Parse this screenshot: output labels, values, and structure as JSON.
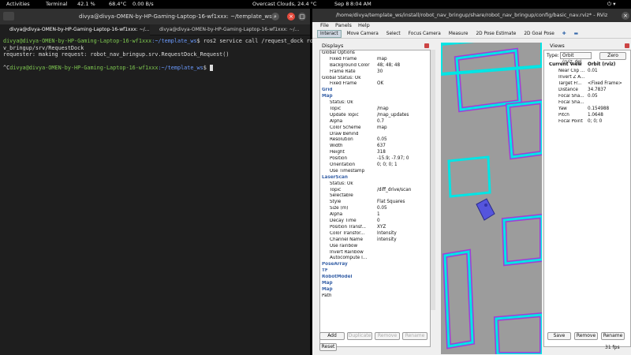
{
  "topbar": {
    "activities": "Activities",
    "terminal": "Terminal",
    "cpu": "42.1 %",
    "temp": "68.4°C",
    "net": "0.00 B/s",
    "weather": "Overcast Clouds, 24.4 °C",
    "date": "Sep 8",
    "time": "8:04 AM"
  },
  "terminal": {
    "title": "divya@divya-OMEN-by-HP-Gaming-Laptop-16-wf1xxx: ~/template_ws",
    "tab1": "divya@divya-OMEN-by-HP-Gaming-Laptop-16-wf1xxx: ~/...",
    "tab2": "divya@divya-OMEN-by-HP-Gaming-Laptop-16-wf1xxx: ~/...",
    "prompt_user": "divya@divya-OMEN-by-HP-Gaming-Laptop-16-wf1xxx",
    "prompt_path": ":~/template_ws",
    "cmd1": "$ ros2 service call /request_dock robot_na",
    "cmd1b": "v_bringup/srv/RequestDock",
    "out1": "requester: making request: robot_nav_bringup.srv.RequestDock_Request()",
    "ctrl": "^C",
    "prompt2_user": "divya@divya-OMEN-by-HP-Gaming-Laptop-16-wf1xxx",
    "prompt2_path": ":~/template_ws",
    "prompt2_end": "$ "
  },
  "rviz": {
    "title": "/home/divya/template_ws/install/robot_nav_bringup/share/robot_nav_bringup/config/basic_nav.rviz* - RViz",
    "menu": [
      "File",
      "Panels",
      "Help"
    ],
    "tools": [
      "Interact",
      "Move Camera",
      "Select",
      "Focus Camera",
      "Measure",
      "2D Pose Estimate",
      "2D Goal Pose"
    ],
    "displays_title": "Displays",
    "views_title": "Views",
    "rows": [
      {
        "k": "Global Options",
        "v": "",
        "d": 0
      },
      {
        "k": "Fixed Frame",
        "v": "map",
        "d": 1
      },
      {
        "k": "Background Color",
        "v": "48; 48; 48",
        "d": 1
      },
      {
        "k": "Frame Rate",
        "v": "30",
        "d": 1
      },
      {
        "k": "Global Status: Ok",
        "v": "",
        "d": 0
      },
      {
        "k": "Fixed Frame",
        "v": "OK",
        "d": 1
      },
      {
        "k": "Grid",
        "v": "",
        "d": 0,
        "s": 1
      },
      {
        "k": "Map",
        "v": "",
        "d": 0,
        "s": 1
      },
      {
        "k": "Status: Ok",
        "v": "",
        "d": 1
      },
      {
        "k": "Topic",
        "v": "/map",
        "d": 1
      },
      {
        "k": "Update Topic",
        "v": "/map_updates",
        "d": 1
      },
      {
        "k": "Alpha",
        "v": "0.7",
        "d": 1
      },
      {
        "k": "Color Scheme",
        "v": "map",
        "d": 1
      },
      {
        "k": "Draw Behind",
        "v": "",
        "d": 1
      },
      {
        "k": "Resolution",
        "v": "0.05",
        "d": 1
      },
      {
        "k": "Width",
        "v": "637",
        "d": 1
      },
      {
        "k": "Height",
        "v": "318",
        "d": 1
      },
      {
        "k": "Position",
        "v": "-15.9; -7.97; 0",
        "d": 1
      },
      {
        "k": "Orientation",
        "v": "0; 0; 0; 1",
        "d": 1
      },
      {
        "k": "Use Timestamp",
        "v": "",
        "d": 1
      },
      {
        "k": "LaserScan",
        "v": "",
        "d": 0,
        "s": 1
      },
      {
        "k": "Status: Ok",
        "v": "",
        "d": 1
      },
      {
        "k": "Topic",
        "v": "/diff_drive/scan",
        "d": 1
      },
      {
        "k": "Selectable",
        "v": "",
        "d": 1
      },
      {
        "k": "Style",
        "v": "Flat Squares",
        "d": 1
      },
      {
        "k": "Size (m)",
        "v": "0.05",
        "d": 1
      },
      {
        "k": "Alpha",
        "v": "1",
        "d": 1
      },
      {
        "k": "Decay Time",
        "v": "0",
        "d": 1
      },
      {
        "k": "Position Transf...",
        "v": "XYZ",
        "d": 1
      },
      {
        "k": "Color Transfor...",
        "v": "Intensity",
        "d": 1
      },
      {
        "k": "Channel Name",
        "v": "intensity",
        "d": 1
      },
      {
        "k": "Use rainbow",
        "v": "",
        "d": 1
      },
      {
        "k": "Invert Rainbow",
        "v": "",
        "d": 1
      },
      {
        "k": "Autocompute I...",
        "v": "",
        "d": 1
      },
      {
        "k": "PoseArray",
        "v": "",
        "d": 0,
        "s": 1
      },
      {
        "k": "TF",
        "v": "",
        "d": 0,
        "s": 1
      },
      {
        "k": "RobotModel",
        "v": "",
        "d": 0,
        "s": 1
      },
      {
        "k": "Map",
        "v": "",
        "d": 0,
        "s": 1
      },
      {
        "k": "Map",
        "v": "",
        "d": 0,
        "s": 1
      },
      {
        "k": "Path",
        "v": "",
        "d": 0
      }
    ],
    "buttons": {
      "add": "Add",
      "duplicate": "Duplicate",
      "remove": "Remove",
      "rename": "Rename",
      "reset": "Reset"
    },
    "views": {
      "type_label": "Type:",
      "type_value": "Orbit (rviz_del",
      "zero": "Zero",
      "current_view": "Current View",
      "current_view_val": "Orbit (rviz)",
      "rows": [
        {
          "k": "Near Clip ...",
          "v": "0.01"
        },
        {
          "k": "Invert Z A...",
          "v": ""
        },
        {
          "k": "Target Fr...",
          "v": "<Fixed Frame>"
        },
        {
          "k": "Distance",
          "v": "34.7837"
        },
        {
          "k": "Focal Sha...",
          "v": "0.05"
        },
        {
          "k": "Focal Sha...",
          "v": ""
        },
        {
          "k": "Yaw",
          "v": "0.154988"
        },
        {
          "k": "Pitch",
          "v": "1.0648"
        },
        {
          "k": "Focal Point",
          "v": "0; 0; 0"
        }
      ],
      "save": "Save",
      "remove": "Remove",
      "rename": "Rename",
      "fps": "31 fps"
    }
  },
  "colors": {
    "accent": "#00e5e5",
    "wall": "#a43bd6",
    "robot": "#5555dd"
  }
}
